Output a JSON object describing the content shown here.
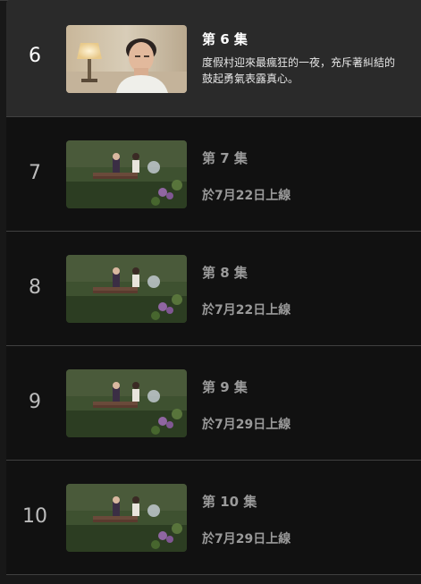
{
  "episodes": [
    {
      "number": "6",
      "title": "第 6 集",
      "description_line1": "度假村迎來最瘋狂的一夜，充斥著糾結的",
      "description_line2": "鼓起勇氣表露真心。",
      "status": "",
      "thumbnail_icon": "portrait-thumbnail"
    },
    {
      "number": "7",
      "title": "第 7 集",
      "description_line1": "",
      "description_line2": "",
      "status": "於7月22日上線",
      "thumbnail_icon": "park-bench-thumbnail"
    },
    {
      "number": "8",
      "title": "第 8 集",
      "description_line1": "",
      "description_line2": "",
      "status": "於7月22日上線",
      "thumbnail_icon": "park-bench-thumbnail"
    },
    {
      "number": "9",
      "title": "第 9 集",
      "description_line1": "",
      "description_line2": "",
      "status": "於7月29日上線",
      "thumbnail_icon": "park-bench-thumbnail"
    },
    {
      "number": "10",
      "title": "第 10 集",
      "description_line1": "",
      "description_line2": "",
      "status": "於7月29日上線",
      "thumbnail_icon": "park-bench-thumbnail"
    }
  ]
}
